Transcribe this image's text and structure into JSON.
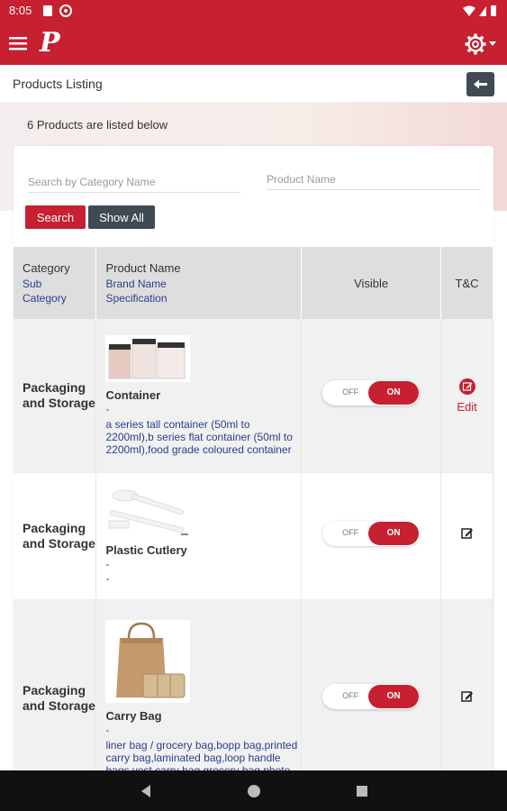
{
  "status_bar": {
    "time": "8:05"
  },
  "app_bar": {
    "logo": "P"
  },
  "subheader": {
    "title": "Products Listing"
  },
  "summary": {
    "count_text": "6 Products are listed below"
  },
  "filters": {
    "category_placeholder": "Search by Category Name",
    "product_placeholder": "Product Name",
    "search_label": "Search",
    "show_all_label": "Show All"
  },
  "table": {
    "headers": {
      "category": "Category",
      "sub_category": "Sub Category",
      "product_name": "Product Name",
      "brand_name": "Brand Name",
      "specification": "Specification",
      "visible": "Visible",
      "tc": "T&C"
    },
    "toggle": {
      "off": "OFF",
      "on": "ON"
    },
    "rows": [
      {
        "category": "Packaging and Storage",
        "product_name": "Container",
        "brand": "-",
        "spec": "a series tall container (50ml to 2200ml),b series flat container (50ml to 2200ml),food grade coloured container",
        "tc_label": "Edit"
      },
      {
        "category": "Packaging and Storage",
        "product_name": "Plastic Cutlery",
        "brand": "-",
        "spec": "-"
      },
      {
        "category": "Packaging and Storage",
        "product_name": "Carry Bag",
        "brand": "-",
        "spec": "liner bag / grocery bag,bopp bag,printed carry bag,laminated bag,loop handle bags,vest carry bag,grocery bag,photo"
      }
    ]
  },
  "colors": {
    "brand": "#c62031",
    "dark": "#3f4a55",
    "link": "#2a3e8c"
  }
}
